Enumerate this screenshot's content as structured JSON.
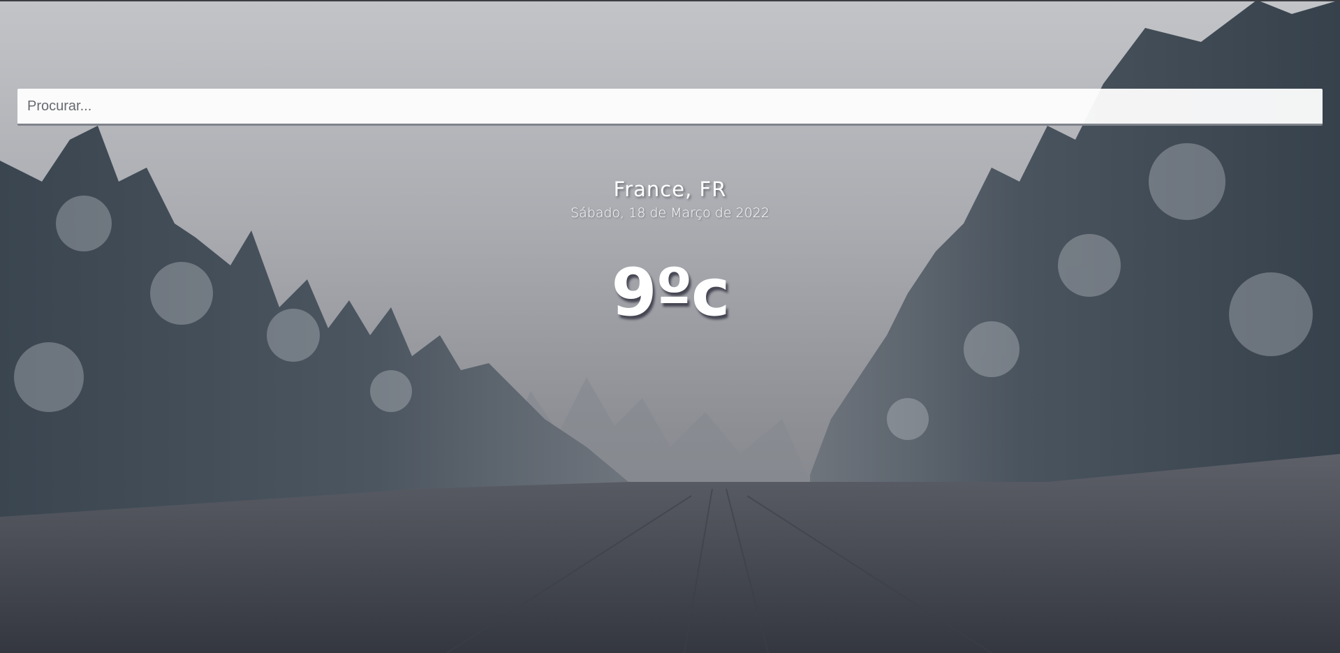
{
  "search": {
    "placeholder": "Procurar..."
  },
  "weather": {
    "location": "France, FR",
    "date": "Sábado, 18 de Março de 2022",
    "temperature": "9ºc"
  },
  "background": {
    "scene": "snowy-forest-road",
    "sky_color": "#bfc1c5",
    "tree_color": "#2c3540",
    "snow_color": "#4a4d55"
  }
}
